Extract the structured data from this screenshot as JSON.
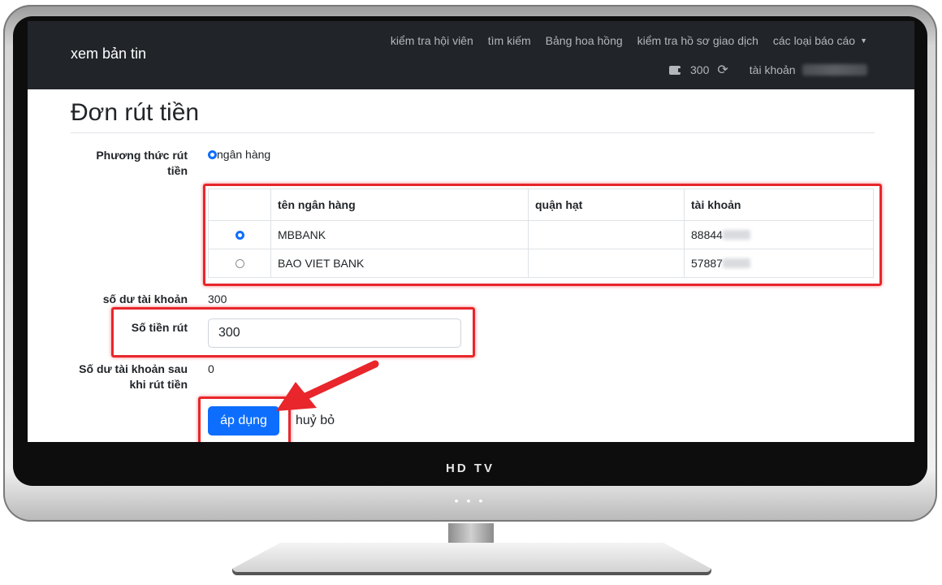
{
  "navbar": {
    "brand": "xem bản tin",
    "links": [
      {
        "label": "kiểm tra hội viên"
      },
      {
        "label": "tìm kiếm"
      },
      {
        "label": "Bảng hoa hồng"
      },
      {
        "label": "kiểm tra hồ sơ giao dịch"
      },
      {
        "label": "các loại báo cáo"
      }
    ],
    "balance": "300",
    "account_label": "tài khoản"
  },
  "page": {
    "title": "Đơn rút tiền"
  },
  "form": {
    "method_label": "Phương thức rút tiền",
    "method_option": "ngân hàng",
    "bank_table": {
      "headers": [
        "tên ngân hàng",
        "quận hạt",
        "tài khoản"
      ],
      "rows": [
        {
          "bank": "MBBANK",
          "district": "",
          "account": "88844",
          "selected": true
        },
        {
          "bank": "BAO VIET BANK",
          "district": "",
          "account": "57887",
          "selected": false
        }
      ]
    },
    "balance_label": "số dư tài khoản",
    "balance_value": "300",
    "amount_label": "Số tiền rút",
    "amount_value": "300",
    "after_balance_label": "Số dư tài khoản sau khi rút tiền",
    "after_balance_value": "0",
    "apply_label": "áp dụng",
    "cancel_label": "huỷ bỏ"
  },
  "tv": {
    "brand": "HD TV"
  },
  "colors": {
    "navbar_bg": "#212529",
    "primary": "#0d6efd",
    "highlight": "#e8262b"
  }
}
